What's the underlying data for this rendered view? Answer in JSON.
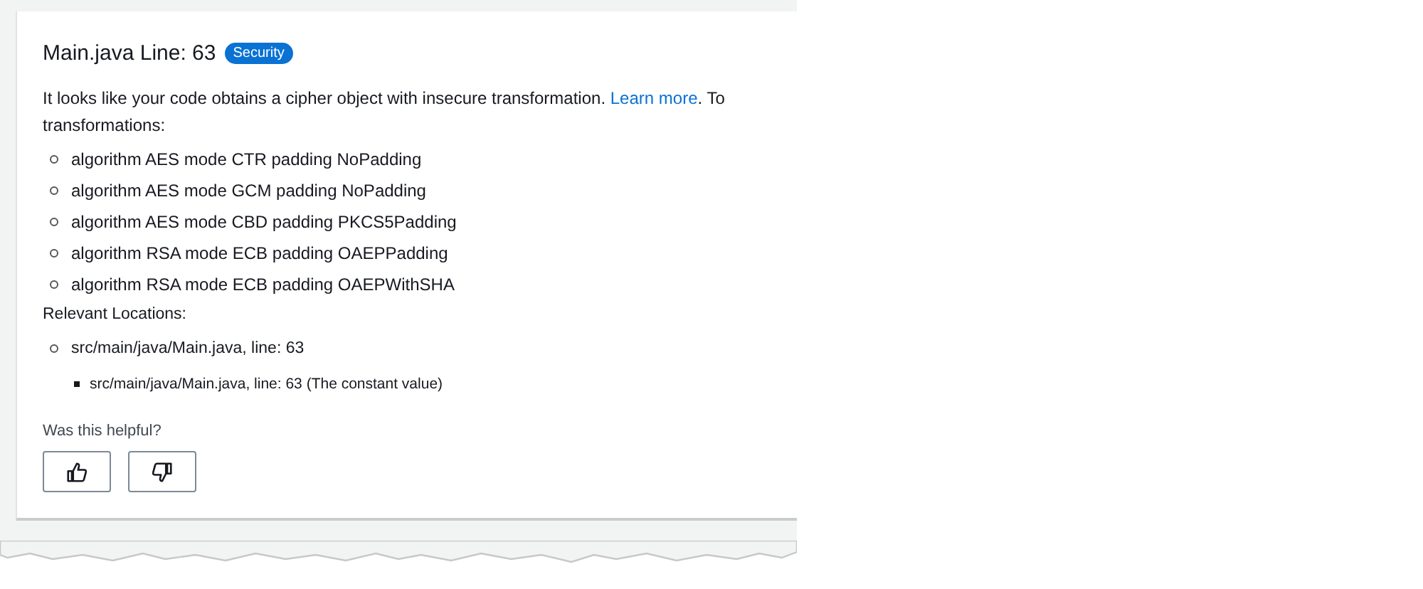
{
  "finding": {
    "title": "Main.java Line: 63",
    "badge": "Security",
    "description": {
      "before": "It looks like your code obtains a cipher object with insecure transformation.",
      "link": "Learn more",
      "after": ". To",
      "continuation": "transformations:"
    },
    "transformations": [
      "algorithm AES mode CTR padding NoPadding",
      "algorithm AES mode GCM padding NoPadding",
      "algorithm AES mode CBD padding PKCS5Padding",
      "algorithm RSA mode ECB padding OAEPPadding",
      "algorithm RSA mode ECB padding OAEPWithSHA"
    ],
    "locations_label": "Relevant Locations:",
    "locations": [
      {
        "text": "src/main/java/Main.java, line: 63",
        "children": [
          {
            "text": "src/main/java/Main.java, line: 63 (The constant value)"
          }
        ]
      }
    ],
    "feedback": {
      "question": "Was this helpful?"
    }
  }
}
